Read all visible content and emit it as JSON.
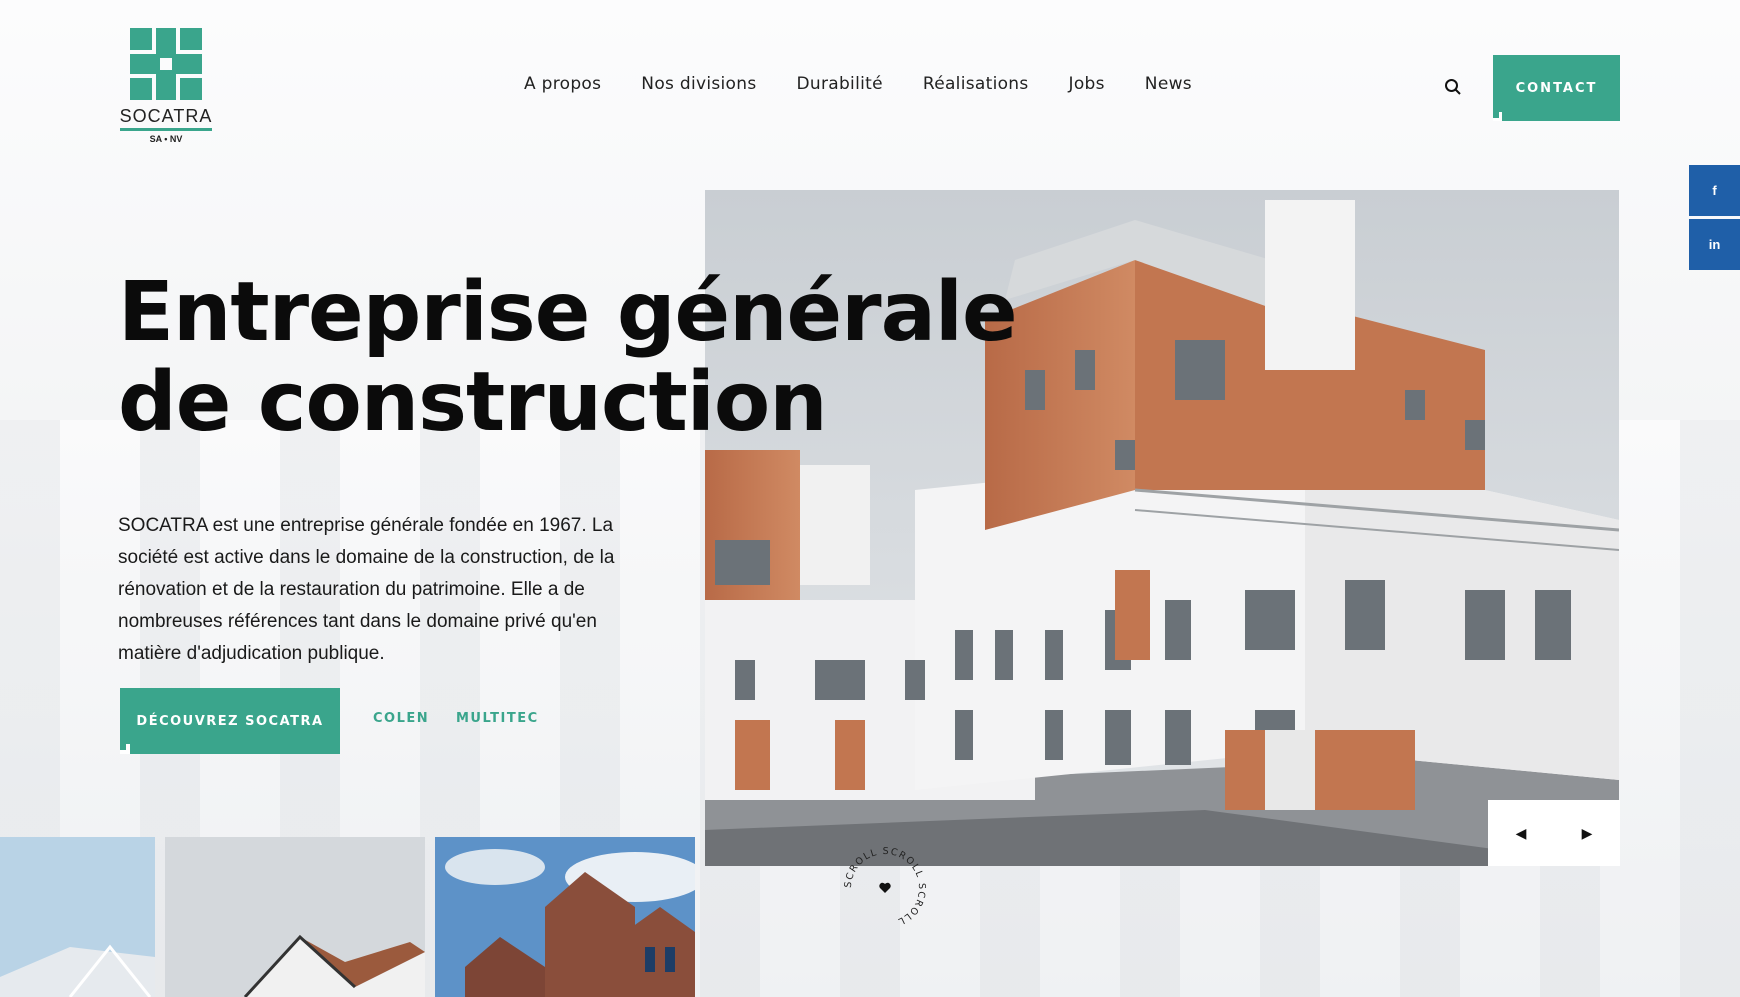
{
  "brand": {
    "name": "SOCATRA",
    "sub": "SA • NV",
    "accent": "#3aa58c",
    "social_color": "#1f5fa8"
  },
  "nav": {
    "items": [
      "A propos",
      "Nos divisions",
      "Durabilité",
      "Réalisations",
      "Jobs",
      "News"
    ]
  },
  "header": {
    "search_icon": "search-icon",
    "contact_label": "CONTACT"
  },
  "social": {
    "facebook": "f",
    "linkedin": "in"
  },
  "hero": {
    "title_line1": "Entreprise générale",
    "title_line2": "de construction",
    "description": "SOCATRA est une entreprise générale fondée en 1967. La société est active dans le domaine de la construction, de la rénovation et de la restauration du patrimoine. Elle a de nombreuses références tant dans le domaine privé qu'en matière d'adjudication publique.",
    "cta_label": "DÉCOUVREZ SOCATRA",
    "link1": "COLEN",
    "link2": "MULTITEC"
  },
  "slider": {
    "prev_icon": "caret-left-icon",
    "next_icon": "caret-right-icon",
    "prev_glyph": "◀",
    "next_glyph": "▶"
  },
  "scroll": {
    "label": "SCROLL SCROLL SCROLL "
  }
}
